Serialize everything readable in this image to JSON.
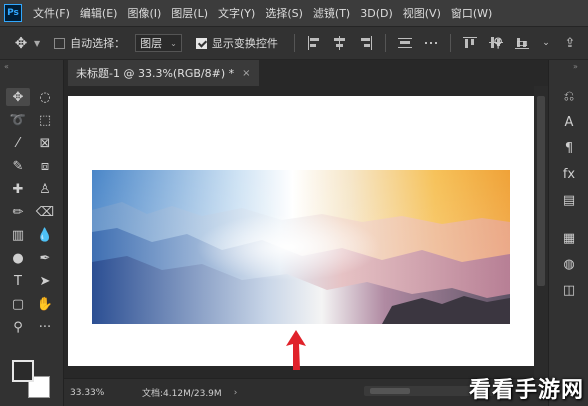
{
  "app": {
    "logo_text": "Ps",
    "menu": [
      "文件(F)",
      "编辑(E)",
      "图像(I)",
      "图层(L)",
      "文字(Y)",
      "选择(S)",
      "滤镜(T)",
      "3D(D)",
      "视图(V)",
      "窗口(W)"
    ]
  },
  "options": {
    "auto_select_label": "自动选择：",
    "auto_select_value": "图层",
    "show_transform_label": "显示变换控件",
    "show_transform_checked": true,
    "auto_select_checked": false
  },
  "document": {
    "tab_title": "未标题-1 @ 33.3%(RGB/8#) *",
    "close_glyph": "×"
  },
  "status": {
    "zoom": "33.33%",
    "doc_info": "文档:4.12M/23.9M",
    "chevron": "›"
  },
  "canvas": {
    "background": "#ffffff",
    "arrow_color": "#e0222a"
  },
  "watermark": "看看手游网",
  "tools": [
    {
      "name": "move-tool-icon",
      "glyph": "✥",
      "active": true
    },
    {
      "name": "marquee-tool-icon",
      "glyph": "◌"
    },
    {
      "name": "lasso-tool-icon",
      "glyph": "➰"
    },
    {
      "name": "object-select-tool-icon",
      "glyph": "⬚"
    },
    {
      "name": "magic-wand-tool-icon",
      "glyph": "⁄"
    },
    {
      "name": "crop-tool-icon",
      "glyph": "⊠"
    },
    {
      "name": "eyedropper-tool-icon",
      "glyph": "✎"
    },
    {
      "name": "frame-tool-icon",
      "glyph": "⧈"
    },
    {
      "name": "healing-brush-tool-icon",
      "glyph": "✚"
    },
    {
      "name": "stamp-tool-icon",
      "glyph": "♙"
    },
    {
      "name": "brush-tool-icon",
      "glyph": "✏"
    },
    {
      "name": "eraser-tool-icon",
      "glyph": "⌫"
    },
    {
      "name": "gradient-tool-icon",
      "glyph": "▥"
    },
    {
      "name": "blur-tool-icon",
      "glyph": "💧"
    },
    {
      "name": "dodge-tool-icon",
      "glyph": "●"
    },
    {
      "name": "pen-tool-icon",
      "glyph": "✒"
    },
    {
      "name": "type-tool-icon",
      "glyph": "T"
    },
    {
      "name": "path-select-tool-icon",
      "glyph": "➤"
    },
    {
      "name": "shape-tool-icon",
      "glyph": "▢"
    },
    {
      "name": "hand-tool-icon",
      "glyph": "✋"
    },
    {
      "name": "zoom-tool-icon",
      "glyph": "⚲"
    },
    {
      "name": "more-tools-icon",
      "glyph": "···"
    }
  ],
  "panels": [
    {
      "name": "history-panel-icon",
      "glyph": "⎌"
    },
    {
      "name": "character-panel-icon",
      "glyph": "A"
    },
    {
      "name": "paragraph-panel-icon",
      "glyph": "¶"
    },
    {
      "name": "styles-panel-icon",
      "glyph": "fx"
    },
    {
      "name": "properties-panel-icon",
      "glyph": "▤"
    },
    {
      "name": "swatches-panel-icon",
      "glyph": "▦"
    },
    {
      "name": "color-panel-icon",
      "glyph": "◍"
    },
    {
      "name": "layers-panel-icon",
      "glyph": "◫"
    }
  ]
}
